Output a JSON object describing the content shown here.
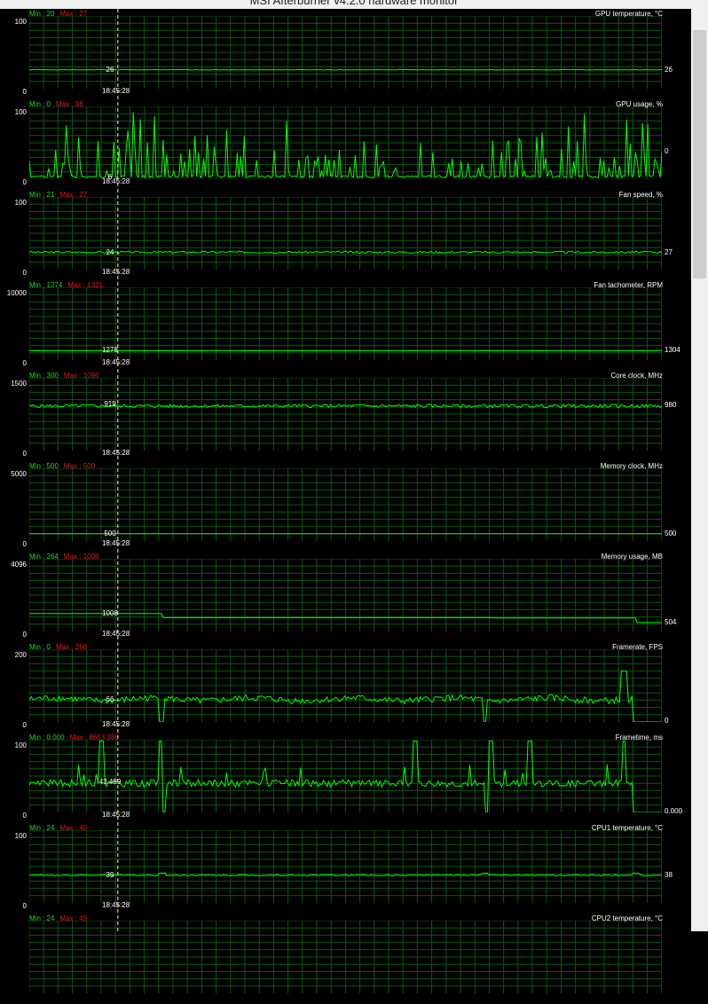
{
  "window": {
    "title": "MSI Afterburner v4.2.0 hardware monitor"
  },
  "colors": {
    "series": "#00ff00",
    "grid": "#0d5a0d",
    "min_label": "#22d622",
    "max_label": "#d81e1e",
    "cursor": "#ffff66"
  },
  "cursor": {
    "time": "18:45:28",
    "position_fraction": 0.14
  },
  "panels": [
    {
      "title": "GPU temperature, °C",
      "min": "Min : 20",
      "max": "Max : 27",
      "ymax": "100",
      "ymin": "0",
      "cursor_value": "26",
      "current": "26",
      "chart_data": {
        "type": "line",
        "ylim": [
          0,
          100
        ],
        "pattern": "flat",
        "level": 26,
        "noise": 0.4,
        "seed": 1
      }
    },
    {
      "title": "GPU usage, %",
      "min": "Min : 0",
      "max": "Max : 98",
      "ymax": "100",
      "ymin": "0",
      "cursor_value": "6",
      "current": "0",
      "chart_data": {
        "type": "line",
        "ylim": [
          0,
          100
        ],
        "pattern": "spiky",
        "level": 2,
        "spike_prob": 0.3,
        "spike_max": 98,
        "seed": 2
      }
    },
    {
      "title": "Fan speed, %",
      "min": "Min : 21",
      "max": "Max : 27",
      "ymax": "100",
      "ymin": "0",
      "cursor_value": "24",
      "current": "27",
      "chart_data": {
        "type": "line",
        "ylim": [
          0,
          100
        ],
        "pattern": "jitter",
        "level": 24,
        "noise": 1.5,
        "seed": 3
      }
    },
    {
      "title": "Fan tachometer, RPM",
      "min": "Min : 1274",
      "max": "Max : 1321",
      "ymax": "10000",
      "ymin": "0",
      "cursor_value": "1278",
      "current": "1304",
      "chart_data": {
        "type": "line",
        "ylim": [
          0,
          10000
        ],
        "pattern": "flat",
        "level": 1290,
        "noise": 10,
        "seed": 4
      }
    },
    {
      "title": "Core clock, MHz",
      "min": "Min : 300",
      "max": "Max : 1096",
      "ymax": "1500",
      "ymin": "0",
      "cursor_value": "919",
      "current": "980",
      "chart_data": {
        "type": "line",
        "ylim": [
          0,
          1500
        ],
        "pattern": "jitter",
        "level": 920,
        "noise": 35,
        "seed": 5
      }
    },
    {
      "title": "Memory clock, MHz",
      "min": "Min : 500",
      "max": "Max : 500",
      "ymax": "5000",
      "ymin": "0",
      "cursor_value": "500",
      "current": "500",
      "chart_data": {
        "type": "line",
        "ylim": [
          0,
          5000
        ],
        "pattern": "flat",
        "level": 500,
        "noise": 0,
        "seed": 6
      }
    },
    {
      "title": "Memory usage, MB",
      "min": "Min : 264",
      "max": "Max : 1008",
      "ymax": "4096",
      "ymin": "0",
      "cursor_value": "1008",
      "current": "504",
      "chart_data": {
        "type": "line",
        "ylim": [
          0,
          4096
        ],
        "pattern": "steps",
        "steps": [
          [
            0,
            1008
          ],
          [
            0.21,
            780
          ],
          [
            0.73,
            760
          ],
          [
            0.96,
            504
          ]
        ],
        "seed": 7
      }
    },
    {
      "title": "Framerate, FPS",
      "min": "Min : 0",
      "max": "Max : 268",
      "ymax": "200",
      "ymin": "0",
      "cursor_value": "66",
      "current": "0",
      "chart_data": {
        "type": "line",
        "ylim": [
          0,
          200
        ],
        "pattern": "noisy",
        "level": 62,
        "noise": 9,
        "dips": [
          0.21,
          0.72
        ],
        "peak_at": 0.94,
        "peak": 140,
        "drop_after": 0.955,
        "seed": 8
      }
    },
    {
      "title": "Frametime, ms",
      "min": "Min : 0.000",
      "max": "Max : 8653.386",
      "ymax": "100",
      "ymin": "0",
      "cursor_value": "43.489",
      "current": "0.000",
      "chart_data": {
        "type": "line",
        "ylim": [
          0,
          100
        ],
        "pattern": "frametime",
        "level": 40,
        "noise": 5,
        "spikes": [
          0.115,
          0.21,
          0.61,
          0.73,
          0.79,
          0.94
        ],
        "dips": [
          0.21,
          0.72
        ],
        "drop_after": 0.955,
        "seed": 9
      }
    },
    {
      "title": "CPU1 temperature, °C",
      "min": "Min : 24",
      "max": "Max : 49",
      "ymax": "100",
      "ymin": "0",
      "cursor_value": "39",
      "current": "38",
      "chart_data": {
        "type": "line",
        "ylim": [
          0,
          100
        ],
        "pattern": "jitter",
        "level": 38,
        "noise": 0.8,
        "bumps": [
          0.21,
          0.72,
          0.96
        ],
        "seed": 10
      }
    },
    {
      "title": "CPU2 temperature, °C",
      "min": "Min : 24",
      "max": "Max : 49",
      "ymax": "",
      "ymin": "",
      "cursor_value": "",
      "current": "",
      "chart_data": {
        "type": "line",
        "ylim": [
          0,
          100
        ],
        "pattern": "none",
        "seed": 11
      }
    }
  ]
}
